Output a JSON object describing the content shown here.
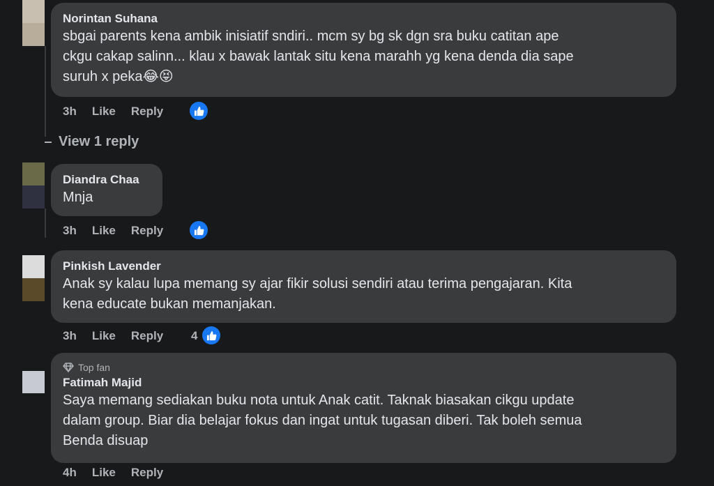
{
  "comments": [
    {
      "name": "Norintan Suhana",
      "lines": [
        "sbgai parents kena ambik inisiatif sndiri.. mcm sy bg sk dgn sra buku catitan ape",
        "ckgu cakap salinn... klau x bawak lantak situ kena marahh yg kena denda dia sape",
        "suruh x peka😂😝"
      ],
      "time": "3h",
      "like_label": "Like",
      "reply_label": "Reply",
      "reaction_count": ""
    },
    {
      "name": "Diandra Chaa",
      "lines": [
        "Mnja"
      ],
      "time": "3h",
      "like_label": "Like",
      "reply_label": "Reply",
      "reaction_count": ""
    },
    {
      "name": "Pinkish Lavender",
      "lines": [
        "Anak sy kalau lupa memang sy ajar fikir solusi sendiri atau terima pengajaran. Kita",
        "kena educate bukan memanjakan."
      ],
      "time": "3h",
      "like_label": "Like",
      "reply_label": "Reply",
      "reaction_count": "4"
    },
    {
      "badge": "Top fan",
      "name": "Fatimah Majid",
      "lines": [
        "Saya memang sediakan buku nota untuk Anak catit. Taknak biasakan cikgu update",
        "dalam group. Biar dia belajar fokus dan ingat untuk tugasan diberi. Tak boleh semua",
        "Benda disuap"
      ],
      "time": "4h",
      "like_label": "Like",
      "reply_label": "Reply"
    }
  ],
  "view_replies_label": "View 1 reply",
  "colors": {
    "background": "#18191a",
    "bubble": "#3a3b3c",
    "text": "#e4e6eb",
    "secondary_text": "#b0b3b8",
    "like_blue": "#1877f2"
  },
  "icons": {
    "like_reaction": "thumbs-up-icon",
    "top_fan": "diamond-icon"
  }
}
